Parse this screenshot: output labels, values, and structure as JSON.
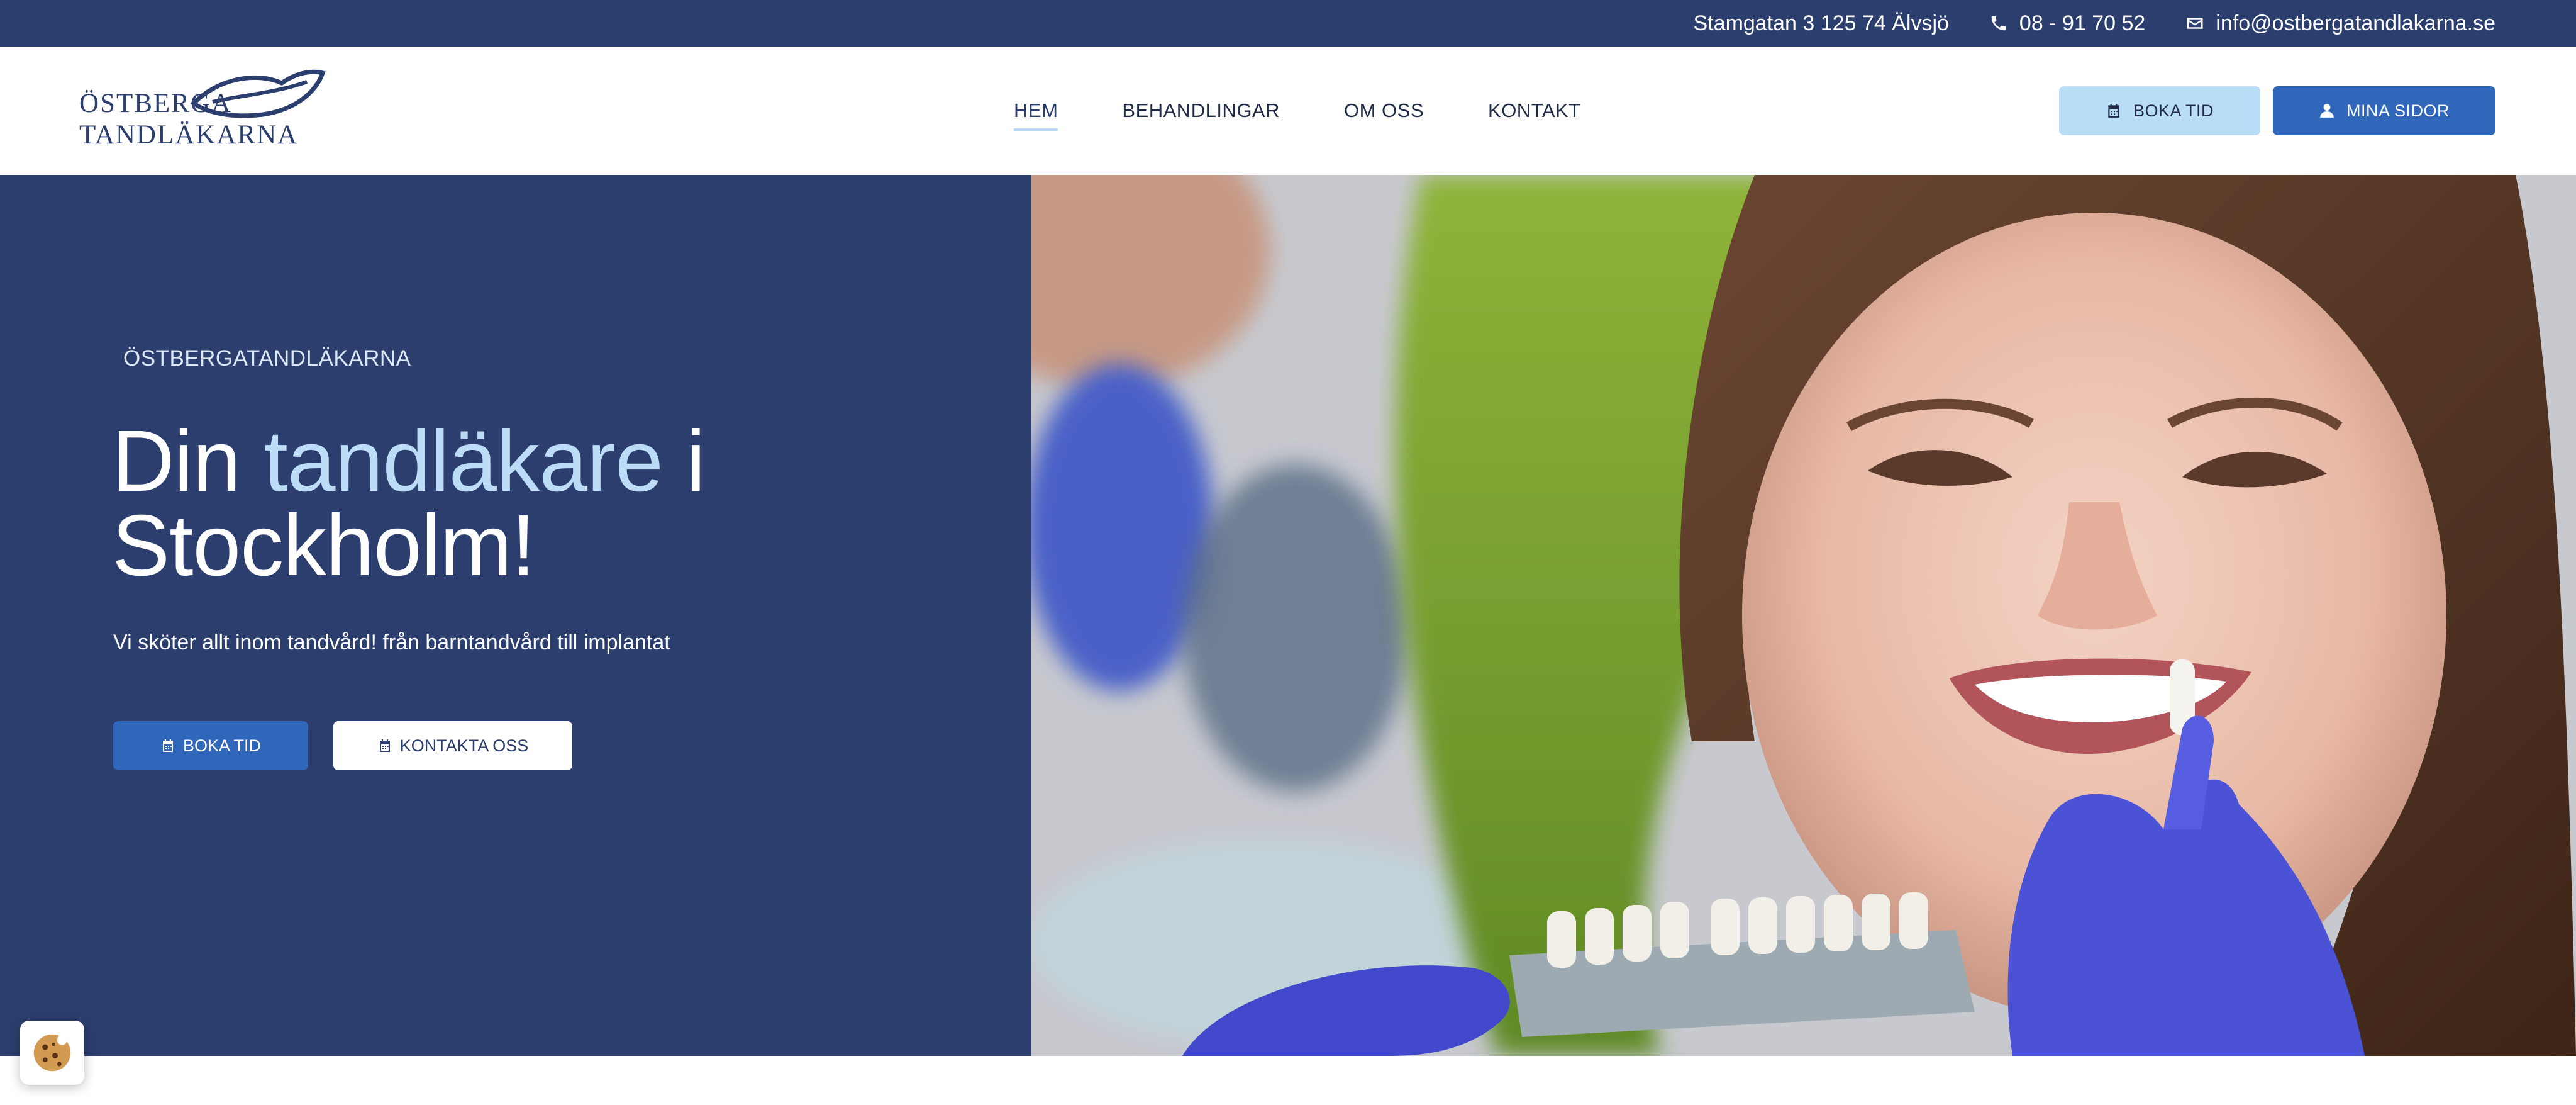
{
  "topbar": {
    "address": "Stamgatan 3   125 74 Älvsjö",
    "phone": "08 - 91 70 52",
    "email": "info@ostbergatandlakarna.se",
    "background": "#2c3e6e"
  },
  "logo": {
    "line1": "ÖSTBERGA",
    "line2": "TANDLÄKARNA"
  },
  "nav": {
    "items": [
      {
        "label": "HEM",
        "active": true
      },
      {
        "label": "BEHANDLINGAR",
        "active": false
      },
      {
        "label": "OM OSS",
        "active": false
      },
      {
        "label": "KONTAKT",
        "active": false
      }
    ]
  },
  "header_buttons": {
    "boka_tid": "BOKA TID",
    "mina_sidor": "MINA SIDOR"
  },
  "hero": {
    "eyebrow": "ÖSTBERGATANDLÄKARNA",
    "title_part1": "Din ",
    "title_accent": "tandläkare",
    "title_part2": " i",
    "title_line2": "Stockholm!",
    "subtitle": "Vi sköter allt inom tandvård! från barntandvård till implantat",
    "button_boka": "BOKA TID",
    "button_kontakta": "KONTAKTA OSS"
  },
  "icons": {
    "phone": "phone-icon",
    "email": "envelope-icon",
    "calendar": "calendar-icon",
    "user": "user-icon",
    "cookie": "cookie-icon",
    "logo_mark": "lips-icon"
  },
  "colors": {
    "navy": "#2c3e6e",
    "accent_blue": "#3167bb",
    "light_blue": "#b9dcf7",
    "title_accent": "#bcdcf8"
  }
}
